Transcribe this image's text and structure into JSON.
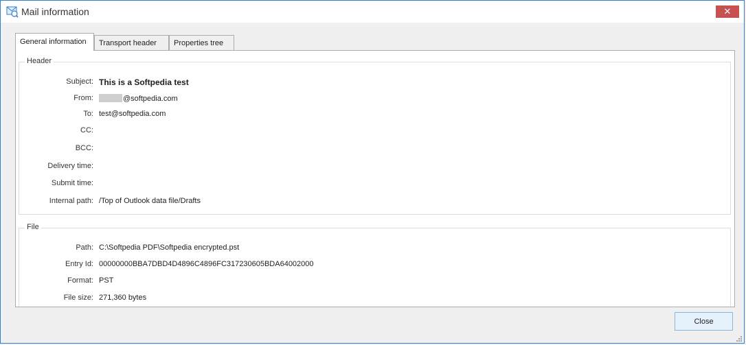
{
  "window": {
    "title": "Mail information",
    "icon": "mail-info-icon",
    "close_glyph": "✕"
  },
  "tabs": [
    {
      "label": "General information",
      "active": true
    },
    {
      "label": "Transport header",
      "active": false
    },
    {
      "label": "Properties tree",
      "active": false
    }
  ],
  "header_group": {
    "legend": "Header",
    "fields": [
      {
        "label": "Subject:",
        "value": "This is a Softpedia test"
      },
      {
        "label": "From:",
        "value": "@softpedia.com"
      },
      {
        "label": "To:",
        "value": "test@softpedia.com"
      },
      {
        "label": "CC:",
        "value": ""
      },
      {
        "label": "BCC:",
        "value": ""
      },
      {
        "label": "Delivery time:",
        "value": ""
      },
      {
        "label": "Submit time:",
        "value": ""
      },
      {
        "label": "Internal path:",
        "value": "/Top of Outlook data file/Drafts"
      }
    ]
  },
  "file_group": {
    "legend": "File",
    "fields": [
      {
        "label": "Path:",
        "value": "C:\\Softpedia PDF\\Softpedia encrypted.pst"
      },
      {
        "label": "Entry Id:",
        "value": "00000000BBA7DBD4D4896C4896FC317230605BDA64002000"
      },
      {
        "label": "Format:",
        "value": "PST"
      },
      {
        "label": "File size:",
        "value": "271,360 bytes"
      }
    ]
  },
  "buttons": {
    "close_label": "Close"
  },
  "colors": {
    "accent": "#2d7fd6",
    "close_x": "#c75050",
    "button_bg": "#e5f1fb"
  }
}
